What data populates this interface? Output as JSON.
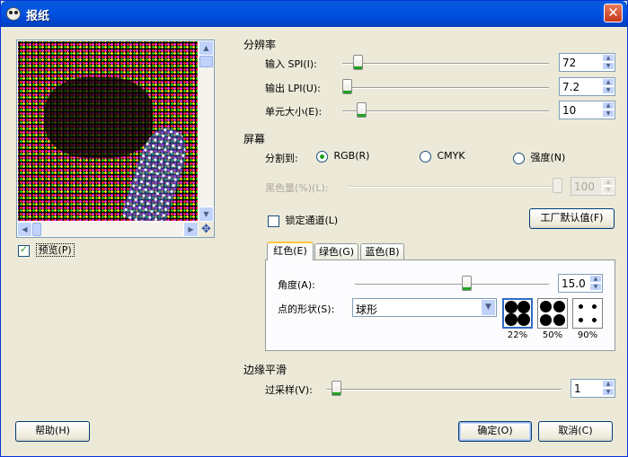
{
  "window": {
    "title": "报纸",
    "close_glyph": "✕"
  },
  "preview": {
    "checkbox_label": "预览(P)",
    "checked": true
  },
  "resolution": {
    "title": "分辨率",
    "input_spi": {
      "label": "输入 SPI(I):",
      "value": "72"
    },
    "output_lpi": {
      "label": "输出 LPI(U):",
      "value": "7.2"
    },
    "cell_size": {
      "label": "单元大小(E):",
      "value": "10"
    }
  },
  "screen": {
    "title": "屏幕",
    "separate_to_label": "分割到:",
    "options": [
      "RGB(R)",
      "CMYK",
      "强度(N)"
    ],
    "selected": "RGB(R)",
    "black_pullout": {
      "label": "黑色量(%)(L):",
      "value": "100"
    },
    "lock_channels_label": "锁定通道(L)",
    "factory_defaults_label": "工厂默认值(F)",
    "tabs": [
      "红色(E)",
      "绿色(G)",
      "蓝色(B)"
    ],
    "active_tab": "红色(E)",
    "angle": {
      "label": "角度(A):",
      "value": "15.0"
    },
    "spot_shape": {
      "label": "点的形状(S):",
      "value": "球形"
    },
    "shape_previews": [
      "22%",
      "50%",
      "90%"
    ]
  },
  "antialiasing": {
    "title": "边缘平滑",
    "oversample": {
      "label": "过采样(V):",
      "value": "1"
    }
  },
  "buttons": {
    "help": "帮助(H)",
    "ok": "确定(O)",
    "cancel": "取消(C)"
  },
  "colors": {
    "titlebar": "#0054e3",
    "dialog_bg": "#ece9d8",
    "focus": "#316ac5",
    "check": "#21a121"
  }
}
